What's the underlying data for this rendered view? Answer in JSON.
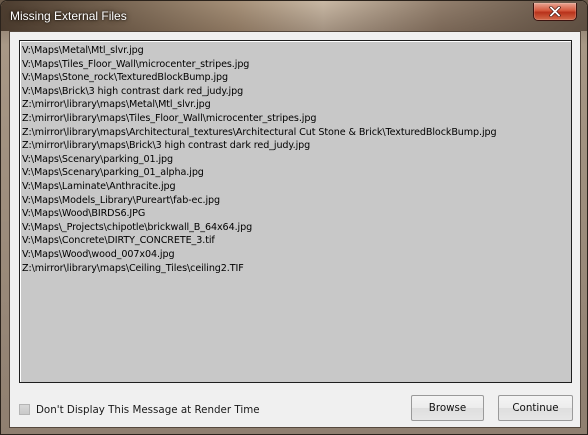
{
  "window": {
    "title": "Missing External Files"
  },
  "files": [
    "V:\\Maps\\Metal\\Mtl_slvr.jpg",
    "V:\\Maps\\Tiles_Floor_Wall\\microcenter_stripes.jpg",
    "V:\\Maps\\Stone_rock\\TexturedBlockBump.jpg",
    "V:\\Maps\\Brick\\3 high contrast dark red_judy.jpg",
    "Z:\\mirror\\library\\maps\\Metal\\Mtl_slvr.jpg",
    "Z:\\mirror\\library\\maps\\Tiles_Floor_Wall\\microcenter_stripes.jpg",
    "Z:\\mirror\\library\\maps\\Architectural_textures\\Architectural Cut Stone & Brick\\TexturedBlockBump.jpg",
    "Z:\\mirror\\library\\maps\\Brick\\3 high contrast dark red_judy.jpg",
    "V:\\Maps\\Scenary\\parking_01.jpg",
    "V:\\Maps\\Scenary\\parking_01_alpha.jpg",
    "V:\\Maps\\Laminate\\Anthracite.jpg",
    "V:\\Maps\\Models_Library\\Pureart\\fab-ec.jpg",
    "V:\\Maps\\Wood\\BIRDS6.JPG",
    "V:\\Maps\\_Projects\\chipotle\\brickwall_B_64x64.jpg",
    "V:\\Maps\\Concrete\\DIRTY_CONCRETE_3.tif",
    "V:\\Maps\\Wood\\wood_007x04.jpg",
    "Z:\\mirror\\library\\maps\\Ceiling_Tiles\\ceiling2.TIF"
  ],
  "options": {
    "dont_display_label": "Don't Display This Message at Render Time",
    "dont_display_checked": false
  },
  "buttons": {
    "browse_label": "Browse",
    "continue_label": "Continue"
  },
  "icons": {
    "close": "close-icon"
  }
}
